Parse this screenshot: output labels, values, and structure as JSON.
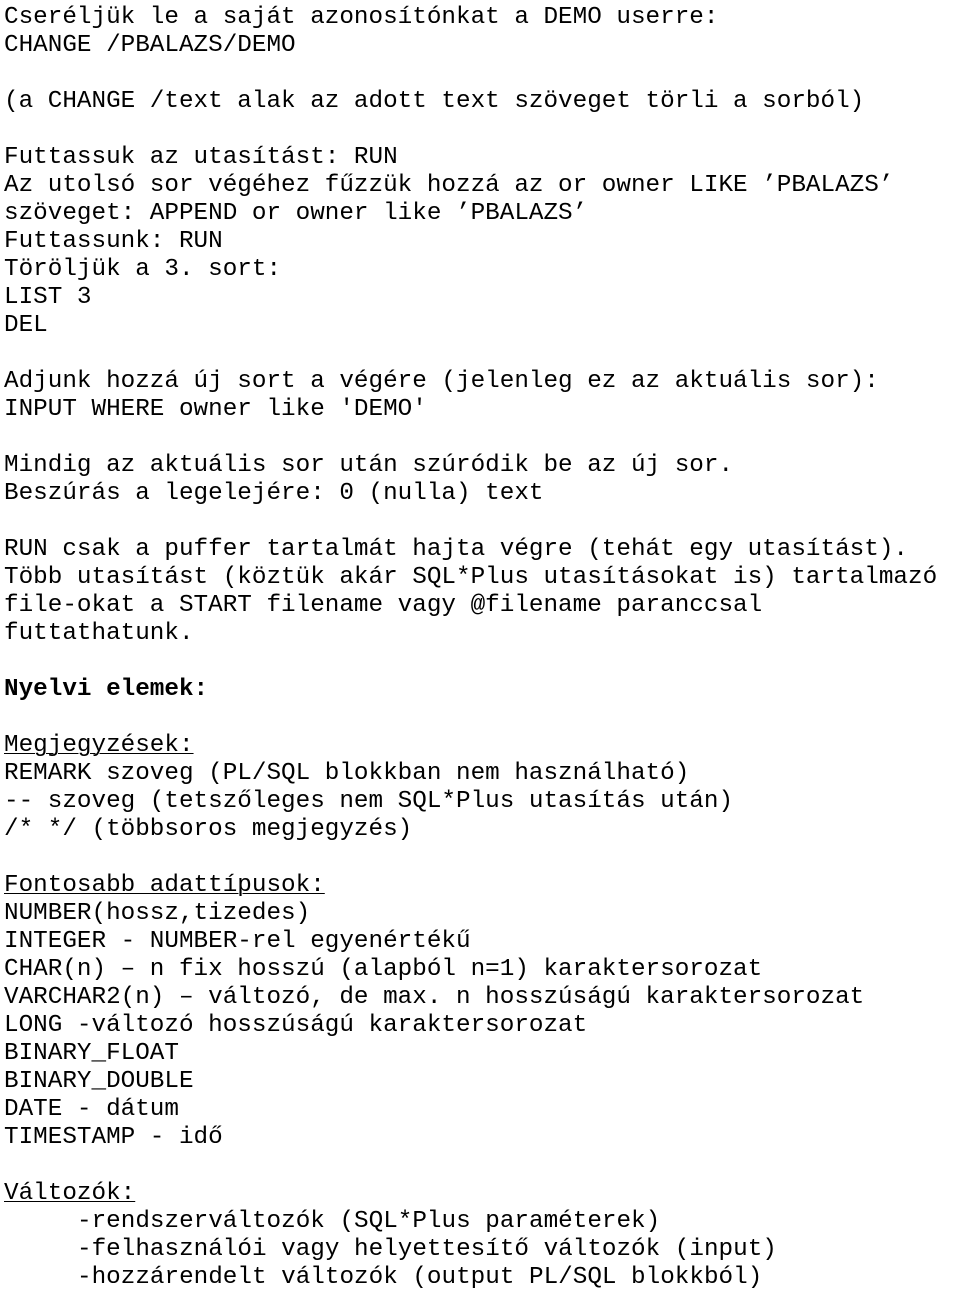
{
  "document": {
    "language": "hu",
    "background_color": "#ffffff",
    "text_color": "#000000",
    "blocks": [
      {
        "id": "change-user",
        "lines": [
          {
            "id": "l1",
            "text": "Cseréljük le a saját azonosítónkat a DEMO userre:",
            "style": "normal"
          },
          {
            "id": "l2",
            "text": "CHANGE /PBALAZS/DEMO",
            "style": "normal"
          }
        ]
      },
      {
        "id": "change-note",
        "lines": [
          {
            "id": "l3",
            "text": "(a CHANGE /text alak az adott text szöveget törli a sorból)",
            "style": "normal"
          }
        ]
      },
      {
        "id": "run-append-del",
        "lines": [
          {
            "id": "l4",
            "text": "Futtassuk az utasítást: RUN",
            "style": "normal"
          },
          {
            "id": "l5",
            "text": "Az utolsó sor végéhez fűzzük hozzá az or owner LIKE ’PBALAZS’",
            "style": "normal"
          },
          {
            "id": "l6",
            "text": "szöveget: APPEND or owner like ’PBALAZS’",
            "style": "normal"
          },
          {
            "id": "l7",
            "text": "Futtassunk: RUN",
            "style": "normal"
          },
          {
            "id": "l8",
            "text": "Töröljük a 3. sort:",
            "style": "normal"
          },
          {
            "id": "l9",
            "text": "LIST 3",
            "style": "normal"
          },
          {
            "id": "l10",
            "text": "DEL",
            "style": "normal"
          }
        ]
      },
      {
        "id": "input-new-line",
        "lines": [
          {
            "id": "l11",
            "text": "Adjunk hozzá új sort a végére (jelenleg ez az aktuális sor):",
            "style": "normal"
          },
          {
            "id": "l12",
            "text": "INPUT WHERE owner like 'DEMO'",
            "style": "normal"
          }
        ]
      },
      {
        "id": "insert-position-note",
        "lines": [
          {
            "id": "l13",
            "text": "Mindig az aktuális sor után szúródik be az új sor.",
            "style": "normal"
          },
          {
            "id": "l14",
            "text": "Beszúrás a legelejére: 0 (nulla) text",
            "style": "normal"
          }
        ]
      },
      {
        "id": "run-buffer-note",
        "lines": [
          {
            "id": "l15",
            "text": "RUN csak a puffer tartalmát hajta végre (tehát egy utasítást).",
            "style": "normal"
          },
          {
            "id": "l16",
            "text": "Több utasítást (köztük akár SQL*Plus utasításokat is) tartalmazó",
            "style": "normal"
          },
          {
            "id": "l17",
            "text": "file-okat a START filename vagy @filename paranccsal",
            "style": "normal"
          },
          {
            "id": "l18",
            "text": "futtathatunk.",
            "style": "normal"
          }
        ]
      },
      {
        "id": "language-elements",
        "lines": [
          {
            "id": "l19",
            "text": "Nyelvi elemek:",
            "style": "bold"
          }
        ]
      },
      {
        "id": "comments",
        "lines": [
          {
            "id": "l20",
            "text": "Megjegyzések:",
            "style": "underline"
          },
          {
            "id": "l21",
            "text": "REMARK szoveg (PL/SQL blokkban nem használható)",
            "style": "normal"
          },
          {
            "id": "l22",
            "text": "-- szoveg (tetszőleges nem SQL*Plus utasítás után)",
            "style": "normal"
          },
          {
            "id": "l23",
            "text": "/* */ (többsoros megjegyzés)",
            "style": "normal"
          }
        ]
      },
      {
        "id": "data-types",
        "lines": [
          {
            "id": "l24",
            "text": "Fontosabb adattípusok:",
            "style": "underline"
          },
          {
            "id": "l25",
            "text": "NUMBER(hossz,tizedes)",
            "style": "normal"
          },
          {
            "id": "l26",
            "text": "INTEGER - NUMBER-rel egyenértékű",
            "style": "normal"
          },
          {
            "id": "l27",
            "text": "CHAR(n) – n fix hosszú (alapból n=1) karaktersorozat",
            "style": "normal"
          },
          {
            "id": "l28",
            "text": "VARCHAR2(n) – változó, de max. n hosszúságú karaktersorozat",
            "style": "normal"
          },
          {
            "id": "l29",
            "text": "LONG -változó hosszúságú karaktersorozat",
            "style": "normal"
          },
          {
            "id": "l30",
            "text": "BINARY_FLOAT",
            "style": "normal"
          },
          {
            "id": "l31",
            "text": "BINARY_DOUBLE",
            "style": "normal"
          },
          {
            "id": "l32",
            "text": "DATE - dátum",
            "style": "normal"
          },
          {
            "id": "l33",
            "text": "TIMESTAMP - idő",
            "style": "normal"
          }
        ]
      },
      {
        "id": "variables",
        "lines": [
          {
            "id": "l34",
            "text": "Változók:",
            "style": "underline"
          },
          {
            "id": "l35",
            "text": "-rendszerváltozók (SQL*Plus paraméterek)",
            "style": "indent"
          },
          {
            "id": "l36",
            "text": "-felhasználói vagy helyettesítő változók (input)",
            "style": "indent"
          },
          {
            "id": "l37",
            "text": "-hozzárendelt változók (output PL/SQL blokkból)",
            "style": "indent"
          }
        ]
      }
    ]
  }
}
